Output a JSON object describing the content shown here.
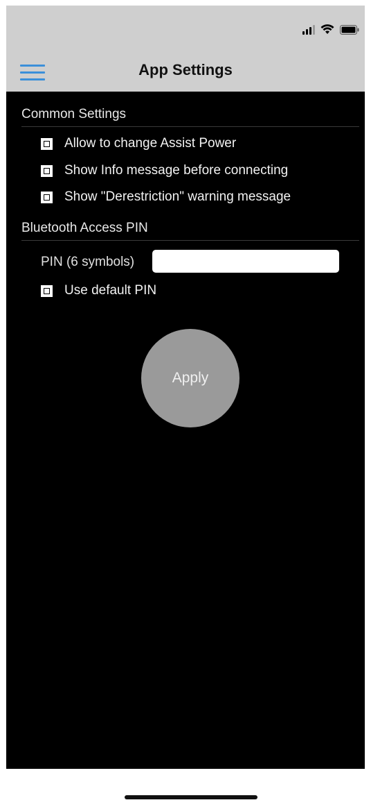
{
  "status_bar": {
    "icons": [
      "signal-icon",
      "wifi-icon",
      "battery-icon"
    ]
  },
  "header": {
    "menu_icon": "hamburger-menu-icon",
    "title": "App Settings",
    "accent_color": "#3b8fd9"
  },
  "common_settings": {
    "title": "Common Settings",
    "options": [
      {
        "label": "Allow to change Assist Power",
        "checked": true
      },
      {
        "label": "Show Info message before connecting",
        "checked": true
      },
      {
        "label": "Show \"Derestriction\" warning message",
        "checked": true
      }
    ]
  },
  "bluetooth": {
    "title": "Bluetooth Access PIN",
    "pin_label": "PIN (6 symbols)",
    "pin_value": "",
    "default_pin_label": "Use default PIN",
    "default_pin_checked": true
  },
  "apply": {
    "label": "Apply"
  }
}
